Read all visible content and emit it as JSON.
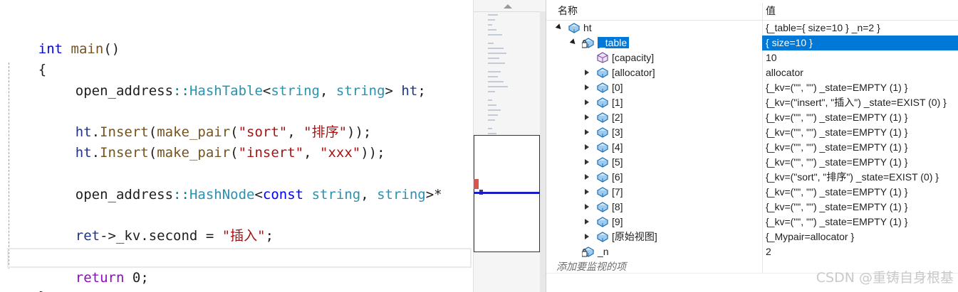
{
  "editor": {
    "lines": [
      [
        "int",
        " ",
        "main",
        "()"
      ],
      [
        "{"
      ],
      [
        "open_address",
        "::",
        "HashTable",
        "<",
        "string",
        ", ",
        "string",
        ">",
        " ",
        "ht",
        ";"
      ],
      [
        "ht",
        ".",
        "Insert",
        "(",
        "make_pair",
        "(",
        "\"sort\"",
        ", ",
        "\"排序\"",
        "));"
      ],
      [
        "ht",
        ".",
        "Insert",
        "(",
        "make_pair",
        "(",
        "\"insert\"",
        ", ",
        "\"xxx\"",
        "));"
      ],
      [
        "open_address",
        "::",
        "HashNode",
        "<",
        "const",
        " ",
        "string",
        ", ",
        "string",
        ">*"
      ],
      [
        "ret",
        "->_kv.second",
        " = ",
        "\"插入\"",
        ";"
      ],
      [
        "return",
        " ",
        "0",
        ";"
      ],
      [
        "}"
      ]
    ]
  },
  "watch": {
    "header": {
      "name": "名称",
      "value": "值"
    },
    "rows": [
      {
        "name": "ht",
        "value": "{_table={ size=10 } _n=2 }",
        "expander": "open",
        "icon": "object-icon",
        "indent": 0
      },
      {
        "name": "_table",
        "value": "{ size=10 }",
        "expander": "open",
        "icon": "private-field-icon",
        "indent": 1,
        "selected": true
      },
      {
        "name": "[capacity]",
        "value": "10",
        "expander": "none",
        "icon": "property-icon",
        "indent": 2
      },
      {
        "name": "[allocator]",
        "value": "allocator",
        "expander": "closed",
        "icon": "object-icon",
        "indent": 2
      },
      {
        "name": "[0]",
        "value": "{_kv=(\"\", \"\") _state=EMPTY (1) }",
        "expander": "closed",
        "icon": "object-icon",
        "indent": 2
      },
      {
        "name": "[1]",
        "value": "{_kv=(\"insert\", \"插入\") _state=EXIST (0) }",
        "expander": "closed",
        "icon": "object-icon",
        "indent": 2
      },
      {
        "name": "[2]",
        "value": "{_kv=(\"\", \"\") _state=EMPTY (1) }",
        "expander": "closed",
        "icon": "object-icon",
        "indent": 2
      },
      {
        "name": "[3]",
        "value": "{_kv=(\"\", \"\") _state=EMPTY (1) }",
        "expander": "closed",
        "icon": "object-icon",
        "indent": 2
      },
      {
        "name": "[4]",
        "value": "{_kv=(\"\", \"\") _state=EMPTY (1) }",
        "expander": "closed",
        "icon": "object-icon",
        "indent": 2
      },
      {
        "name": "[5]",
        "value": "{_kv=(\"\", \"\") _state=EMPTY (1) }",
        "expander": "closed",
        "icon": "object-icon",
        "indent": 2
      },
      {
        "name": "[6]",
        "value": "{_kv=(\"sort\", \"排序\") _state=EXIST (0) }",
        "expander": "closed",
        "icon": "object-icon",
        "indent": 2
      },
      {
        "name": "[7]",
        "value": "{_kv=(\"\", \"\") _state=EMPTY (1) }",
        "expander": "closed",
        "icon": "object-icon",
        "indent": 2
      },
      {
        "name": "[8]",
        "value": "{_kv=(\"\", \"\") _state=EMPTY (1) }",
        "expander": "closed",
        "icon": "object-icon",
        "indent": 2
      },
      {
        "name": "[9]",
        "value": "{_kv=(\"\", \"\") _state=EMPTY (1) }",
        "expander": "closed",
        "icon": "object-icon",
        "indent": 2
      },
      {
        "name": "[原始视图]",
        "value": "{_Mypair=allocator }",
        "expander": "closed",
        "icon": "object-icon",
        "indent": 2
      },
      {
        "name": "_n",
        "value": "2",
        "expander": "none",
        "icon": "private-field-icon",
        "indent": 1
      }
    ],
    "add_placeholder": "添加要监视的项"
  },
  "watermark": "CSDN @重铸自身根基"
}
